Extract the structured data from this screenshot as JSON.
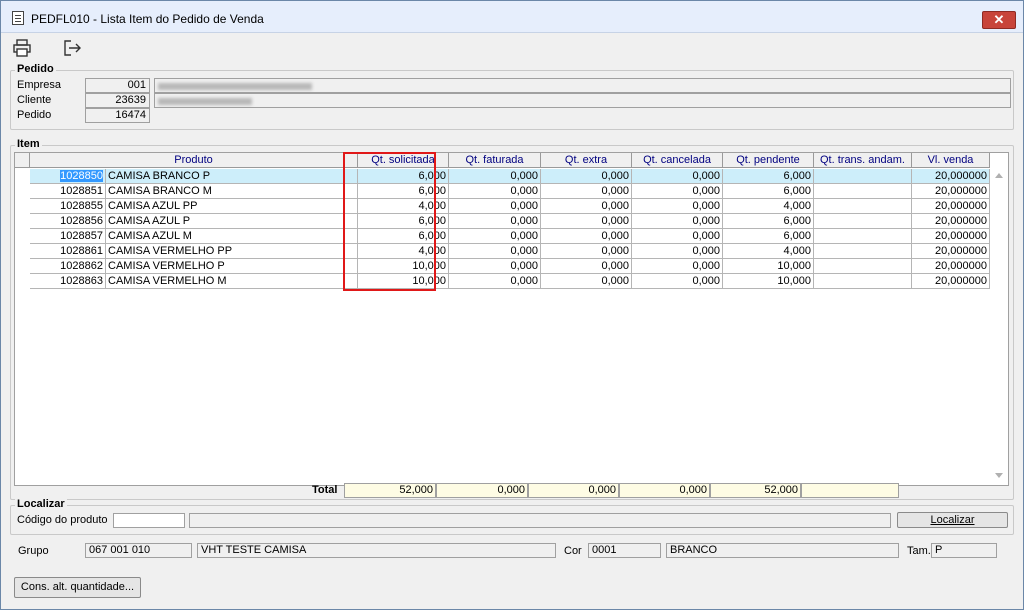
{
  "window": {
    "title": "PEDFL010 - Lista Item do Pedido de Venda",
    "close_glyph": "✕"
  },
  "toolbar": {
    "print_icon": "printer-icon",
    "exit_icon": "exit-icon"
  },
  "pedido": {
    "legend": "Pedido",
    "empresa_label": "Empresa",
    "empresa_code": "001",
    "cliente_label": "Cliente",
    "cliente_code": "23639",
    "pedido_label": "Pedido",
    "pedido_number": "16474"
  },
  "item": {
    "legend": "Item",
    "columns": [
      "Produto",
      "Qt. solicitada",
      "Qt. faturada",
      "Qt. extra",
      "Qt. cancelada",
      "Qt. pendente",
      "Qt. trans. andam.",
      "Vl. venda"
    ],
    "rows": [
      {
        "code": "1028850",
        "produto": "CAMISA BRANCO P",
        "solicitada": "6,000",
        "faturada": "0,000",
        "extra": "0,000",
        "cancelada": "0,000",
        "pendente": "6,000",
        "trans": "",
        "venda": "20,000000"
      },
      {
        "code": "1028851",
        "produto": "CAMISA BRANCO M",
        "solicitada": "6,000",
        "faturada": "0,000",
        "extra": "0,000",
        "cancelada": "0,000",
        "pendente": "6,000",
        "trans": "",
        "venda": "20,000000"
      },
      {
        "code": "1028855",
        "produto": "CAMISA AZUL PP",
        "solicitada": "4,000",
        "faturada": "0,000",
        "extra": "0,000",
        "cancelada": "0,000",
        "pendente": "4,000",
        "trans": "",
        "venda": "20,000000"
      },
      {
        "code": "1028856",
        "produto": "CAMISA AZUL P",
        "solicitada": "6,000",
        "faturada": "0,000",
        "extra": "0,000",
        "cancelada": "0,000",
        "pendente": "6,000",
        "trans": "",
        "venda": "20,000000"
      },
      {
        "code": "1028857",
        "produto": "CAMISA AZUL M",
        "solicitada": "6,000",
        "faturada": "0,000",
        "extra": "0,000",
        "cancelada": "0,000",
        "pendente": "6,000",
        "trans": "",
        "venda": "20,000000"
      },
      {
        "code": "1028861",
        "produto": "CAMISA VERMELHO PP",
        "solicitada": "4,000",
        "faturada": "0,000",
        "extra": "0,000",
        "cancelada": "0,000",
        "pendente": "4,000",
        "trans": "",
        "venda": "20,000000"
      },
      {
        "code": "1028862",
        "produto": "CAMISA VERMELHO P",
        "solicitada": "10,000",
        "faturada": "0,000",
        "extra": "0,000",
        "cancelada": "0,000",
        "pendente": "10,000",
        "trans": "",
        "venda": "20,000000"
      },
      {
        "code": "1028863",
        "produto": "CAMISA VERMELHO M",
        "solicitada": "10,000",
        "faturada": "0,000",
        "extra": "0,000",
        "cancelada": "0,000",
        "pendente": "10,000",
        "trans": "",
        "venda": "20,000000"
      }
    ],
    "total_label": "Total",
    "totals": {
      "solicitada": "52,000",
      "faturada": "0,000",
      "extra": "0,000",
      "cancelada": "0,000",
      "pendente": "52,000",
      "trans": ""
    }
  },
  "localizar": {
    "legend": "Localizar",
    "codigo_label": "Código do produto",
    "codigo_value": "",
    "button_label": "Localizar"
  },
  "info": {
    "grupo_label": "Grupo",
    "grupo_code": "067 001 010",
    "grupo_name": "VHT TESTE CAMISA",
    "cor_label": "Cor",
    "cor_code": "0001",
    "cor_name": "BRANCO",
    "tam_label": "Tam.",
    "tam_value": "P"
  },
  "footer": {
    "cons_button_label": "Cons. alt. quantidade..."
  },
  "colors": {
    "header_text": "#000080",
    "selected_row": "#cdeefa",
    "selected_code": "#3399ff",
    "highlight_border": "#e01818",
    "total_field": "#fefce4"
  }
}
